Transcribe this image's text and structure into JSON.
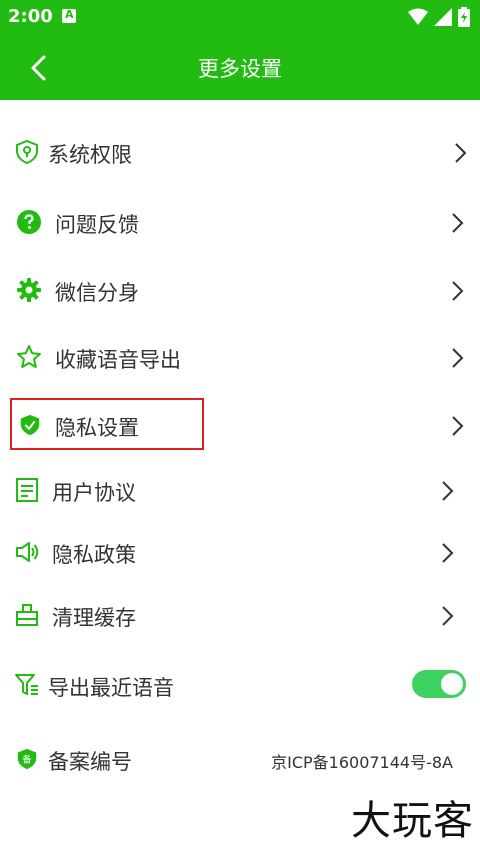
{
  "status": {
    "time": "2:00",
    "badge": "A"
  },
  "header": {
    "title": "更多设置"
  },
  "items": [
    {
      "label": "系统权限"
    },
    {
      "label": "问题反馈"
    },
    {
      "label": "微信分身"
    },
    {
      "label": "收藏语音导出"
    },
    {
      "label": "隐私设置"
    },
    {
      "label": "用户协议"
    },
    {
      "label": "隐私政策"
    },
    {
      "label": "清理缓存"
    },
    {
      "label": "导出最近语音",
      "toggle": true
    },
    {
      "label": "备案编号",
      "value": "京ICP备16007144号-8A"
    }
  ],
  "watermark": {
    "text": "大玩客"
  },
  "colors": {
    "primary": "#22bb11",
    "toggle_on": "#3dd260",
    "highlight": "#e02020"
  }
}
